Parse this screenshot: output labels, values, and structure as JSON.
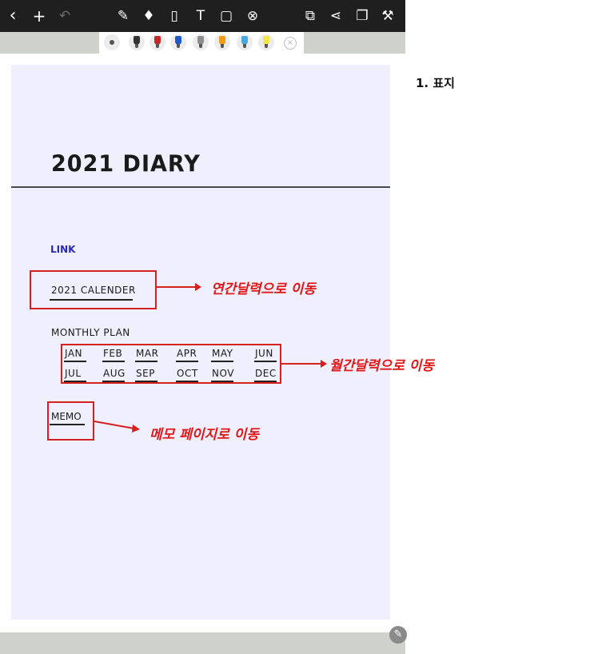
{
  "toolbar": {
    "back_icon": "chevron-left-icon",
    "back_glyph": "‹",
    "add_glyph": "+",
    "undo_glyph": "↶",
    "tools": [
      {
        "name": "pen-select-icon",
        "glyph": "✎"
      },
      {
        "name": "highlighter-icon",
        "glyph": "♦"
      },
      {
        "name": "eraser-icon",
        "glyph": "▯"
      },
      {
        "name": "text-tool-icon",
        "glyph": "T"
      },
      {
        "name": "shape-tool-icon",
        "glyph": "▢"
      },
      {
        "name": "lasso-clear-icon",
        "glyph": "⊗"
      }
    ],
    "right_tools": [
      {
        "name": "layers-icon",
        "glyph": "⧉"
      },
      {
        "name": "share-icon",
        "glyph": "⋖"
      },
      {
        "name": "pages-icon",
        "glyph": "❐"
      },
      {
        "name": "settings-wrench-icon",
        "glyph": "⚒"
      }
    ]
  },
  "pens": [
    {
      "name": "dot-pen",
      "color": "#b9b9b9"
    },
    {
      "name": "black-pen",
      "color": "#333333"
    },
    {
      "name": "red-pen",
      "color": "#c62828"
    },
    {
      "name": "blue-pen",
      "color": "#1e57c8"
    },
    {
      "name": "gray-pen",
      "color": "#8d8d8d"
    },
    {
      "name": "orange-pen",
      "color": "#f39c12"
    },
    {
      "name": "lightblue-pen",
      "color": "#4aa8e0"
    },
    {
      "name": "yellow-pen",
      "color": "#f2e64a"
    }
  ],
  "page": {
    "title": "2021 DIARY",
    "link_label": "LINK",
    "calendar_link": "2021 CALENDER",
    "monthly_label": "MONTHLY PLAN",
    "months_row1": [
      "JAN",
      "FEB",
      "MAR",
      "APR",
      "MAY",
      "JUN"
    ],
    "months_row2": [
      "JUL",
      "AUG",
      "SEP",
      "OCT",
      "NOV",
      "DEC"
    ],
    "memo_link": "MEMO"
  },
  "annotations": {
    "calendar_note": "연간달력으로 이동",
    "monthly_note": "월간달력으로 이동",
    "memo_note": "메모 페이지로 이동",
    "accent_color": "#d61f1f"
  },
  "section_title": "1. 표지",
  "edit_glyph": "✎"
}
